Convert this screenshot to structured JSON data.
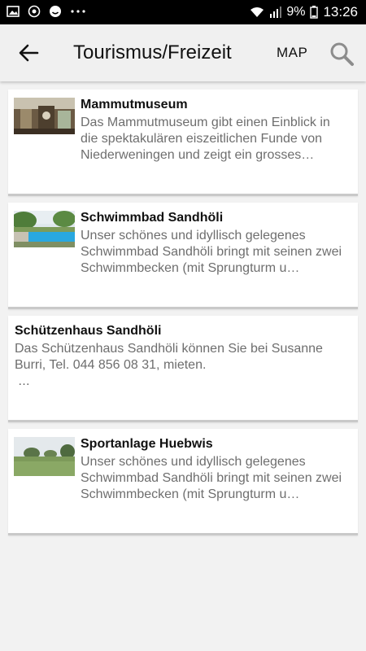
{
  "status_bar": {
    "time": "13:26",
    "battery": "9%",
    "notification_icons": [
      "image-icon",
      "sync-icon",
      "smiley-icon",
      "more-dots-icon"
    ]
  },
  "app_bar": {
    "title": "Tourismus/Freizeit",
    "map_label": "MAP"
  },
  "cards": [
    {
      "title": "Mammutmuseum",
      "description": "Das Mammutmuseum gibt einen Einblick in die spektakulären eiszeitlichen Funde von Niederweningen und zeigt ein grosses…"
    },
    {
      "title": "Schwimmbad Sandhöli",
      "description": "Unser schönes und idyllisch gelegenes Schwimmbad Sandhöli bringt mit seinen zwei Schwimmbecken (mit Sprungturm u…"
    },
    {
      "title": "Schützenhaus Sandhöli",
      "description": "Das Schützenhaus Sandhöli können Sie bei Susanne Burri, Tel. 044 856 08 31, mieten.",
      "extra": "…"
    },
    {
      "title": "Sportanlage Huebwis",
      "description": "Unser schönes und idyllisch gelegenes Schwimmbad Sandhöli bringt mit seinen zwei Schwimmbecken (mit Sprungturm u…"
    }
  ]
}
